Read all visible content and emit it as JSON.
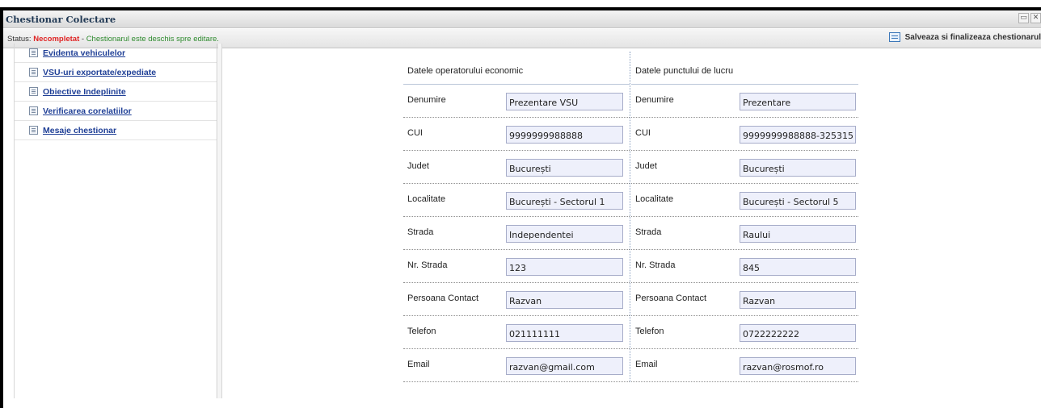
{
  "window": {
    "title": "Chestionar Colectare",
    "buttons": [
      "restore-icon",
      "close-icon"
    ]
  },
  "statusbar": {
    "label": "Status:",
    "value": "Necompletat",
    "separator": "-",
    "message": "Chestionarul este deschis spre editare.",
    "save_label": "Salveaza si finalizeaza chestionarul",
    "colors": {
      "status": "#e02424",
      "message": "#2e8b2e"
    }
  },
  "sidebar": {
    "items": [
      {
        "label": "Evidenta vehiculelor",
        "icon": "document-icon"
      },
      {
        "label": "VSU-uri exportate/expediate",
        "icon": "document-icon"
      },
      {
        "label": "Obiective Indeplinite",
        "icon": "document-icon"
      },
      {
        "label": "Verificarea corelatiilor",
        "icon": "document-icon"
      },
      {
        "label": "Mesaje chestionar",
        "icon": "document-icon"
      }
    ]
  },
  "form": {
    "operator": {
      "heading": "Datele operatorului economic",
      "rows": [
        {
          "label": "Denumire",
          "value": "Prezentare VSU"
        },
        {
          "label": "CUI",
          "value": "9999999988888"
        },
        {
          "label": "Judet",
          "value": "București"
        },
        {
          "label": "Localitate",
          "value": "București - Sectorul 1"
        },
        {
          "label": "Strada",
          "value": "Independentei"
        },
        {
          "label": "Nr. Strada",
          "value": "123"
        },
        {
          "label": "Persoana Contact",
          "value": "Razvan"
        },
        {
          "label": "Telefon",
          "value": "021111111"
        },
        {
          "label": "Email",
          "value": "razvan@gmail.com"
        }
      ]
    },
    "workpoint": {
      "heading": "Datele punctului de lucru",
      "rows": [
        {
          "label": "Denumire",
          "value": "Prezentare"
        },
        {
          "label": "CUI",
          "value": "9999999988888-325315"
        },
        {
          "label": "Judet",
          "value": "București"
        },
        {
          "label": "Localitate",
          "value": "București - Sectorul 5"
        },
        {
          "label": "Strada",
          "value": "Raului"
        },
        {
          "label": "Nr. Strada",
          "value": "845"
        },
        {
          "label": "Persoana Contact",
          "value": "Razvan"
        },
        {
          "label": "Telefon",
          "value": "0722222222"
        },
        {
          "label": "Email",
          "value": "razvan@rosmof.ro"
        }
      ]
    }
  }
}
